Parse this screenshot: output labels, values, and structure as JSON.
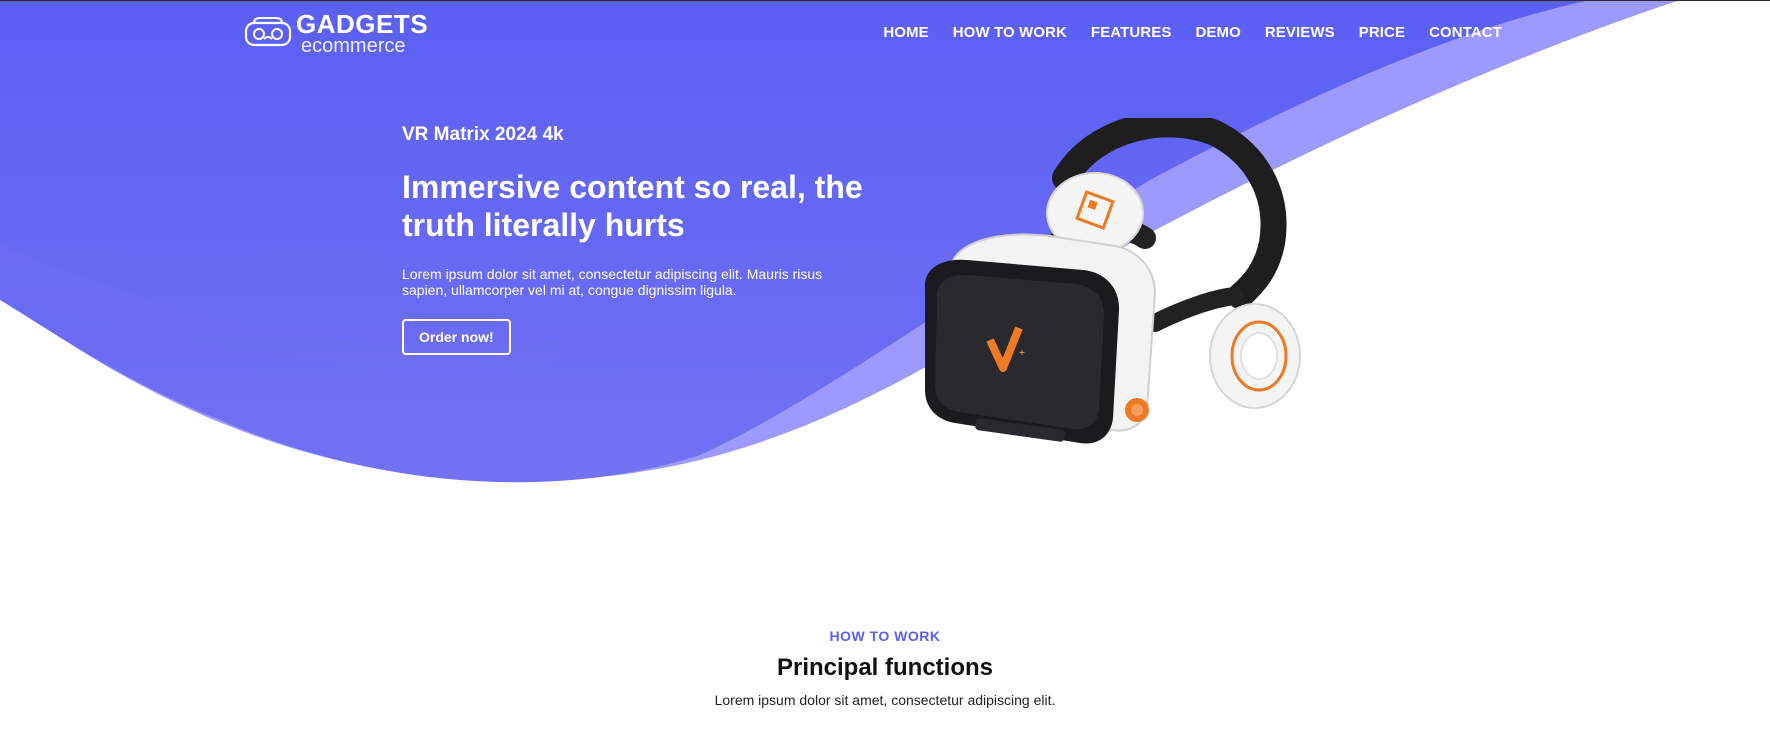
{
  "colors": {
    "primary": "#5b5ff0",
    "secondary": "#6d6df3",
    "accent_wave": "#9b98ff",
    "text_light": "#ffffff",
    "brand_orange": "#ee7a24"
  },
  "header": {
    "logo": {
      "title": "GADGETS",
      "subtitle": "ecommerce",
      "icon": "vr-headset-icon"
    },
    "nav": [
      {
        "label": "HOME"
      },
      {
        "label": "HOW TO WORK"
      },
      {
        "label": "FEATURES"
      },
      {
        "label": "DEMO"
      },
      {
        "label": "REVIEWS"
      },
      {
        "label": "PRICE"
      },
      {
        "label": "CONTACT"
      }
    ]
  },
  "hero": {
    "product_name": "VR Matrix 2024 4k",
    "headline": "Immersive content so real, the truth literally hurts",
    "lede": "Lorem ipsum dolor sit amet, consectetur adipiscing elit. Mauris risus sapien, ullamcorper vel mi at, congue dignissim ligula.",
    "cta": "Order now!"
  },
  "section": {
    "eyebrow": "HOW TO WORK",
    "title": "Principal functions",
    "subtitle": "Lorem ipsum dolor sit amet, consectetur adipiscing elit."
  }
}
